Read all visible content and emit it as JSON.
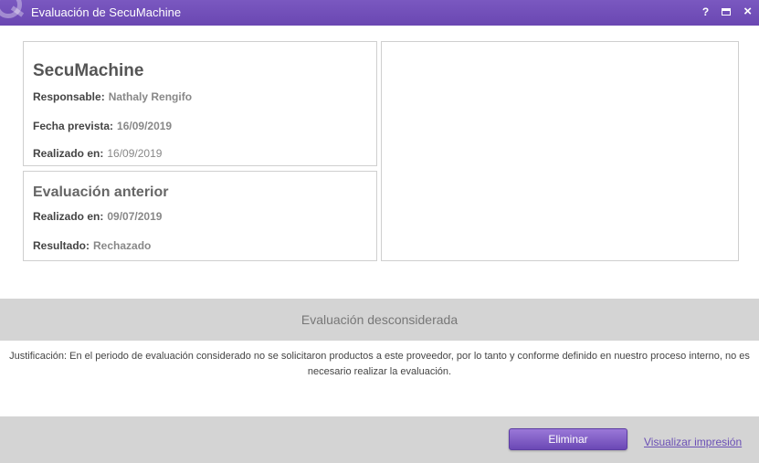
{
  "window": {
    "title": "Evaluación de SecuMachine",
    "help_label": "?",
    "close_label": "×",
    "accent_color": "#6a47b2"
  },
  "evaluation": {
    "name": "SecuMachine",
    "responsable_label": "Responsable:",
    "responsable_value": "Nathaly Rengifo",
    "fecha_label": "Fecha prevista:",
    "fecha_value": "16/09/2019",
    "realizado_label": "Realizado en:",
    "realizado_value": "16/09/2019"
  },
  "previous": {
    "heading": "Evaluación anterior",
    "realizado_label": "Realizado en:",
    "realizado_value": "09/07/2019",
    "resultado_label": "Resultado:",
    "resultado_value": "Rechazado"
  },
  "status": {
    "text": "Evaluación desconsiderada"
  },
  "justification": {
    "text": "Justificación: En el periodo de evaluación considerado no se solicitaron productos a este proveedor, por lo tanto y conforme definido en nuestro proceso interno, no es necesario realizar la evaluación."
  },
  "footer": {
    "delete_label": "Eliminar",
    "print_label": "Visualizar impresión"
  }
}
